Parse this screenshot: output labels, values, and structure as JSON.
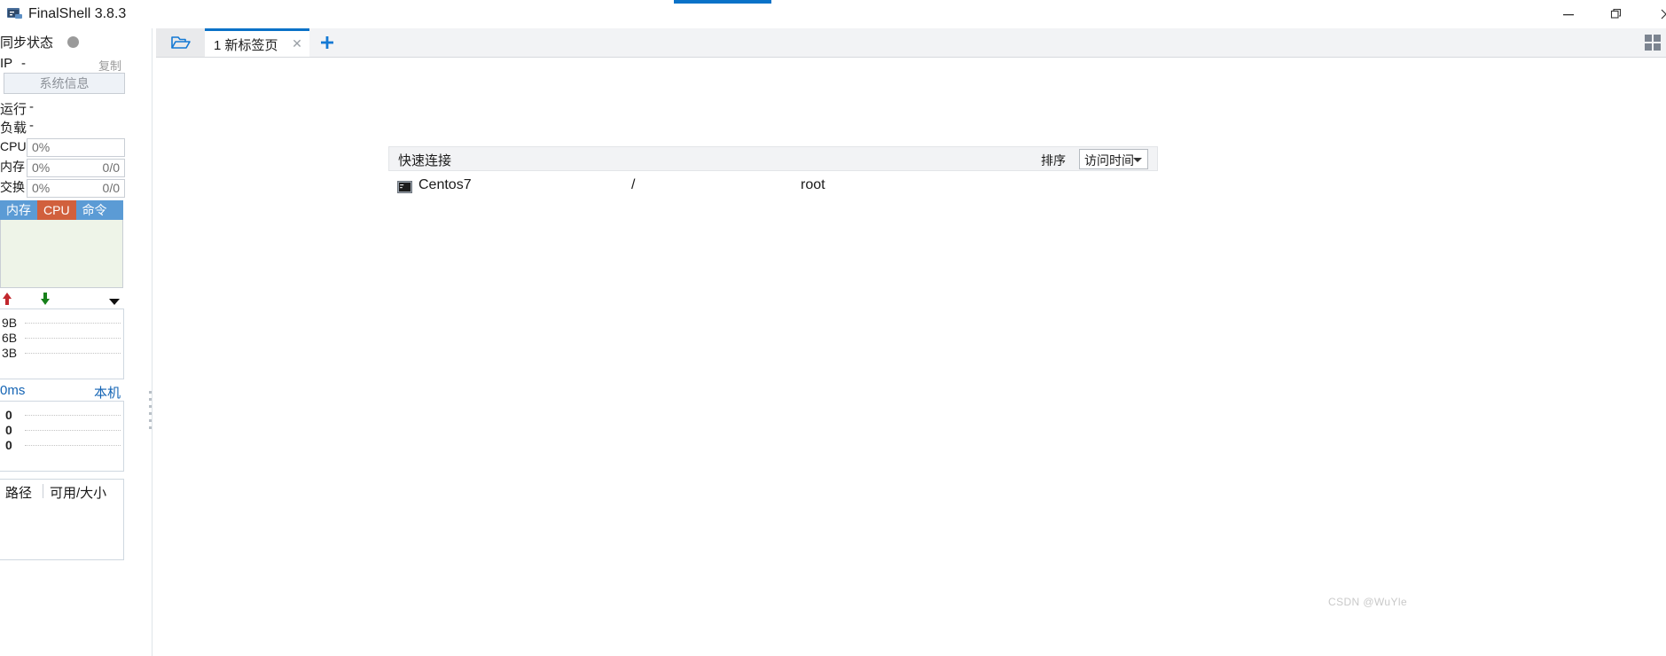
{
  "window": {
    "title": "FinalShell 3.8.3",
    "app_icon": "terminal-icon",
    "minimize_label": "—",
    "maximize_label": "❐",
    "close_label": "✕"
  },
  "sidebar": {
    "sync_status_label": "同步状态",
    "sync_status_color": "#9a9a9a",
    "ip_label": "IP",
    "ip_value": "-",
    "copy_label": "复制",
    "system_info_button": "系统信息",
    "uptime_label": "运行",
    "uptime_value": "-",
    "load_label": "负载",
    "load_value": "-",
    "meters": [
      {
        "label": "CPU",
        "percent": "0%",
        "fraction": ""
      },
      {
        "label": "内存",
        "percent": "0%",
        "fraction": "0/0"
      },
      {
        "label": "交换",
        "percent": "0%",
        "fraction": "0/0"
      }
    ],
    "resource_tabs": [
      {
        "label": "内存",
        "active": false
      },
      {
        "label": "CPU",
        "active": true
      },
      {
        "label": "命令",
        "active": false
      }
    ],
    "tab_bg_color": "#5b9bd5",
    "tab_active_color": "#d1603d",
    "network": {
      "upload_icon": "arrow-up-icon",
      "download_icon": "arrow-down-icon",
      "menu_icon": "chevron-down-icon",
      "y_labels": [
        "9B",
        "6B",
        "3B"
      ]
    },
    "ping": {
      "latency": "0ms",
      "host": "本机",
      "y_labels": [
        "0",
        "0",
        "0"
      ],
      "text_color": "#1464b4"
    },
    "disk": {
      "col_path": "路径",
      "col_size": "可用/大小",
      "rows": []
    }
  },
  "main": {
    "folder_button_icon": "folder-open-icon",
    "tabs": [
      {
        "label": "1 新标签页",
        "close_label": "✕",
        "active": true
      }
    ],
    "add_tab_label": "+",
    "grid_button_icon": "grid-icon",
    "accent_color": "#0a72c8",
    "quick_connect": {
      "title": "快速连接",
      "sort_label": "排序",
      "sort_value": "访问时间",
      "connections": [
        {
          "icon": "terminal-icon",
          "name": "Centos7",
          "path": "/",
          "user": "root"
        }
      ]
    }
  },
  "watermark": "CSDN @WuYle"
}
